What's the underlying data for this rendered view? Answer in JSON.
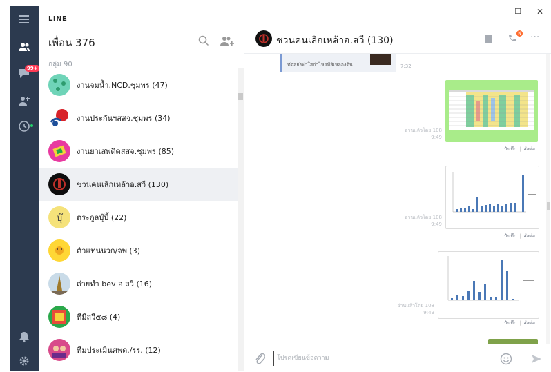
{
  "app": {
    "brand": "LINE"
  },
  "nav": {
    "chat_badge": "99+"
  },
  "friends": {
    "header": "เพื่อน 376",
    "group_label": "กลุ่ม 90",
    "items": [
      {
        "name": "งานจมน้ำ.NCD.ชุมพร (47)"
      },
      {
        "name": "งานประกันฯสสจ.ชุมพร (34)"
      },
      {
        "name": "งานยาเสพติดสสจ.ชุมพร (85)"
      },
      {
        "name": "ชวนคนเลิกเหล้าอ.สวี (130)"
      },
      {
        "name": "ตระกูลบุ๊บี้ (22)"
      },
      {
        "name": "ตัวแทนนวก/จพ (3)"
      },
      {
        "name": "ถ่ายทำ bev อ สวี (16)"
      },
      {
        "name": "ทีมีสวี๕๘ (4)"
      },
      {
        "name": "ทีมประเมินศพด./รร. (12)"
      }
    ]
  },
  "window": {
    "minimize": "–",
    "maximize": "☐",
    "close": "✕"
  },
  "chat": {
    "title": "ชวนคนเลิกเหล้าอ.สวี (130)",
    "call_badge": "N",
    "more": "···",
    "quote_text": "ทัดสยังทำใสก่าไหยมีสิเหลองต้น",
    "quote_time": "7:32",
    "messages": [
      {
        "read": "อ่านแล้วโดย 108",
        "time": "9:49",
        "save": "บันทึก",
        "share": "ส่งต่อ"
      },
      {
        "read": "อ่านแล้วโดย 108",
        "time": "9:49",
        "save": "บันทึก",
        "share": "ส่งต่อ"
      },
      {
        "read": "อ่านแล้วโดย 108",
        "time": "9:49",
        "save": "บันทึก",
        "share": "ส่งต่อ"
      }
    ],
    "input_placeholder": "โปรดเขียนข้อความ"
  },
  "colors": {
    "rail": "#2c3a4f",
    "badge": "#ff3b55",
    "sheet_bg": "#a9ec8a",
    "chart_bar": "#4a78b6"
  }
}
